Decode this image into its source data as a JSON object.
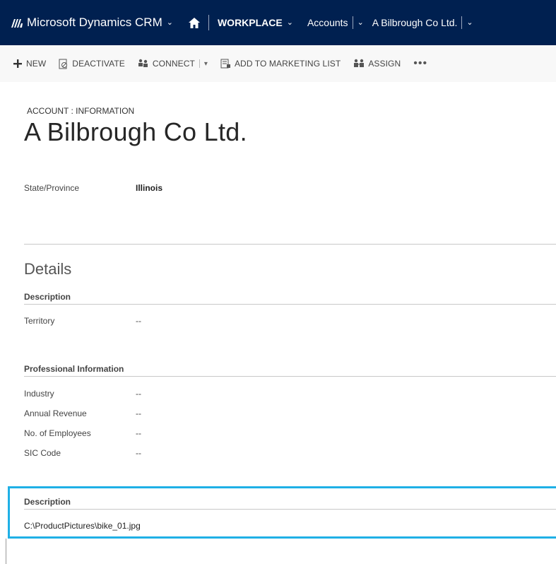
{
  "navbar": {
    "app_name": "Microsoft Dynamics CRM",
    "area": "WORKPLACE",
    "entity": "Accounts",
    "record": "A Bilbrough Co Ltd."
  },
  "commands": {
    "new": "NEW",
    "deactivate": "DEACTIVATE",
    "connect": "CONNECT",
    "add_to_marketing_list": "ADD TO MARKETING LIST",
    "assign": "ASSIGN",
    "more": "•••"
  },
  "header": {
    "form_type": "ACCOUNT : INFORMATION",
    "title": "A Bilbrough Co Ltd.",
    "field_label": "State/Province",
    "field_value": "Illinois"
  },
  "details": {
    "title": "Details",
    "description_section": {
      "heading": "Description",
      "fields": [
        {
          "label": "Territory",
          "value": "--"
        }
      ]
    },
    "professional_section": {
      "heading": "Professional Information",
      "fields": [
        {
          "label": "Industry",
          "value": "--"
        },
        {
          "label": "Annual Revenue",
          "value": "--"
        },
        {
          "label": "No. of Employees",
          "value": "--"
        },
        {
          "label": "SIC Code",
          "value": "--"
        }
      ]
    },
    "highlighted_section": {
      "heading": "Description",
      "value": "C:\\ProductPictures\\bike_01.jpg",
      "highlight_color": "#1fb0e6"
    }
  },
  "colors": {
    "navbar_bg": "#002050",
    "command_bar_bg": "#f8f8f8"
  }
}
